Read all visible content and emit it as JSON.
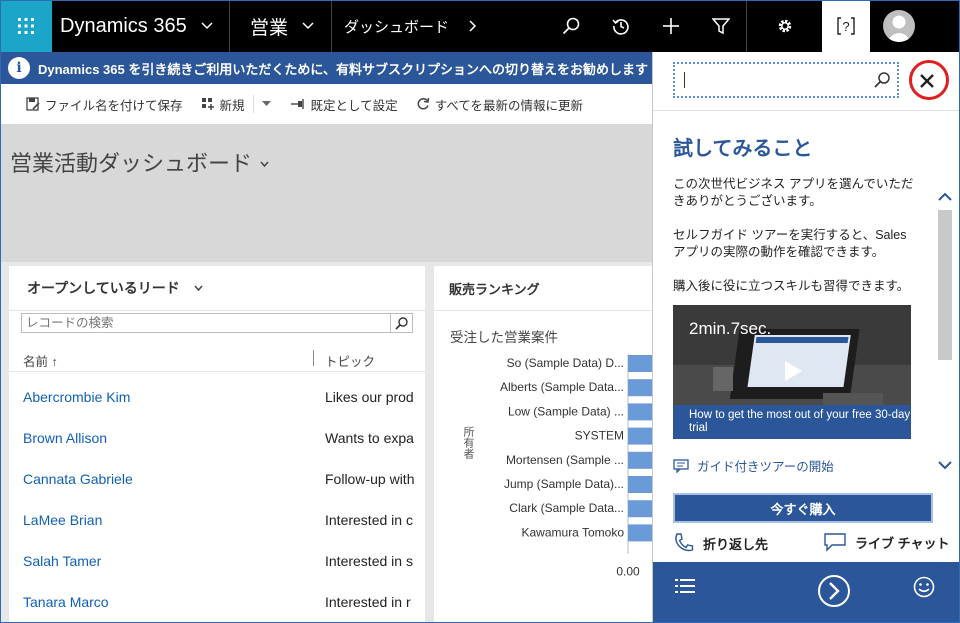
{
  "nav": {
    "brand": "Dynamics 365",
    "area": "営業",
    "breadcrumb": "ダッシュボード"
  },
  "notification": {
    "text": "Dynamics 365 を引き続きご利用いただくために、有料サブスクリプションへの切り替えをお勧めします"
  },
  "commands": {
    "save_as": "ファイル名を付けて保存",
    "new": "新規",
    "set_default": "既定として設定",
    "refresh_all": "すべてを最新の情報に更新"
  },
  "dashboard": {
    "title": "営業活動ダッシュボード"
  },
  "leads": {
    "title": "オープンしているリード",
    "search_placeholder": "レコードの検索",
    "col_name": "名前 ↑",
    "col_topic": "トピック",
    "rows": [
      {
        "name": "Abercrombie Kim",
        "topic": "Likes our prod"
      },
      {
        "name": "Brown Allison",
        "topic": "Wants to expa"
      },
      {
        "name": "Cannata Gabriele",
        "topic": "Follow-up with"
      },
      {
        "name": "LaMee Brian",
        "topic": "Interested in c"
      },
      {
        "name": "Salah Tamer",
        "topic": "Interested in s"
      },
      {
        "name": "Tanara Marco",
        "topic": "Interested in r"
      }
    ]
  },
  "ranking": {
    "title": "販売ランキング"
  },
  "chart_data": {
    "type": "bar",
    "title": "受注した営業案件",
    "ylabel": "所有者",
    "categories": [
      "So (Sample Data) D...",
      "Alberts (Sample Data...",
      "Low (Sample Data) ...",
      "SYSTEM",
      "Mortensen (Sample ...",
      "Jump (Sample Data)...",
      "Clark (Sample Data...",
      "Kawamura Tomoko"
    ],
    "x_tick": "0.00",
    "bar_color": "#6a9bd8"
  },
  "help": {
    "search_value": "",
    "title": "試してみること",
    "p1": "この次世代ビジネス アプリを選んでいただきありがとうございます。",
    "p2": "セルフガイド ツアーを実行すると、Sales アプリの実際の動作を確認できます。",
    "p3": "購入後に役に立つスキルも習得できます。",
    "video_title": "2min.7sec.",
    "video_caption": "How to get the most out of your free 30-day trial",
    "tour_link": "ガイド付きツアーの開始",
    "buy_button": "今すぐ購入",
    "callback": "折り返し先",
    "live_chat": "ライブ チャット"
  },
  "colors": {
    "accent": "#2b579a",
    "waffle": "#1aa5c9",
    "link": "#1160b7",
    "close_ring": "#e02020"
  }
}
